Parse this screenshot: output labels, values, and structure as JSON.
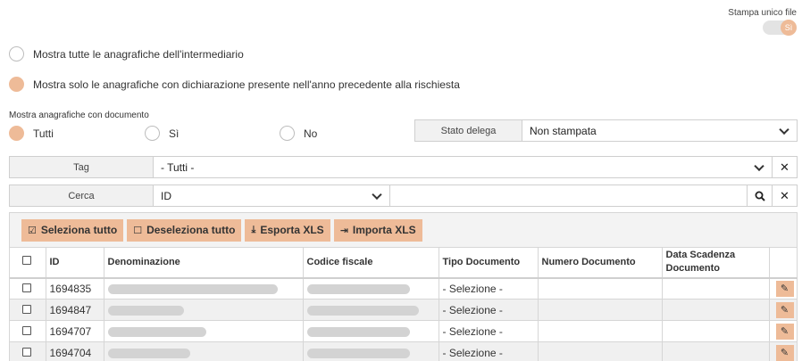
{
  "toggle": {
    "label": "Stampa unico file",
    "value": "Sì"
  },
  "radios_main": [
    {
      "label": "Mostra tutte le anagrafiche dell'intermediario",
      "selected": false
    },
    {
      "label": "Mostra solo le anagrafiche con dichiarazione presente nell'anno precedente alla rischiesta",
      "selected": true
    }
  ],
  "documento_filter": {
    "label": "Mostra anagrafiche con documento",
    "options": [
      {
        "label": "Tutti",
        "selected": true
      },
      {
        "label": "Sì",
        "selected": false
      },
      {
        "label": "No",
        "selected": false
      }
    ]
  },
  "stato_delega": {
    "label": "Stato delega",
    "value": "Non stampata"
  },
  "tag": {
    "label": "Tag",
    "value": "- Tutti -",
    "clear": "✕"
  },
  "cerca": {
    "label": "Cerca",
    "field": "ID",
    "query": "",
    "clear": "✕"
  },
  "toolbar": {
    "select_all": "Seleziona tutto",
    "deselect_all": "Deseleziona tutto",
    "export": "Esporta XLS",
    "import": "Importa XLS"
  },
  "table": {
    "headers": {
      "id": "ID",
      "denominazione": "Denominazione",
      "codice_fiscale": "Codice fiscale",
      "tipo_documento": "Tipo Documento",
      "numero_documento": "Numero Documento",
      "data_scadenza": "Data Scadenza Documento"
    },
    "rows": [
      {
        "id": "1694835",
        "tipo": "- Selezione -"
      },
      {
        "id": "1694847",
        "tipo": "- Selezione -"
      },
      {
        "id": "1694707",
        "tipo": "- Selezione -"
      },
      {
        "id": "1694704",
        "tipo": "- Selezione -"
      }
    ]
  }
}
